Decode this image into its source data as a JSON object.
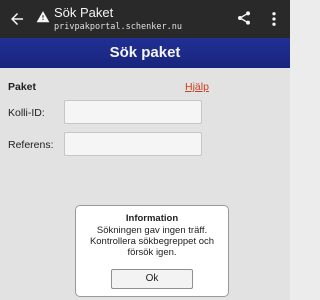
{
  "browser": {
    "title": "Sök Paket",
    "url": "privpakportal.schenker.nu",
    "icons": {
      "back": "back-arrow-icon",
      "warning": "warning-icon",
      "share": "share-icon",
      "more": "more-vert-icon"
    }
  },
  "header": {
    "title": "Sök paket",
    "color": "#1f2b8c"
  },
  "form": {
    "section_label": "Paket",
    "help_label": "Hjälp",
    "fields": [
      {
        "label": "Kolli-ID:",
        "value": ""
      },
      {
        "label": "Referens:",
        "value": ""
      }
    ]
  },
  "dialog": {
    "title": "Information",
    "message": "Sökningen gav ingen träff. Kontrollera sökbegreppet och försök igen.",
    "ok_label": "Ok"
  }
}
